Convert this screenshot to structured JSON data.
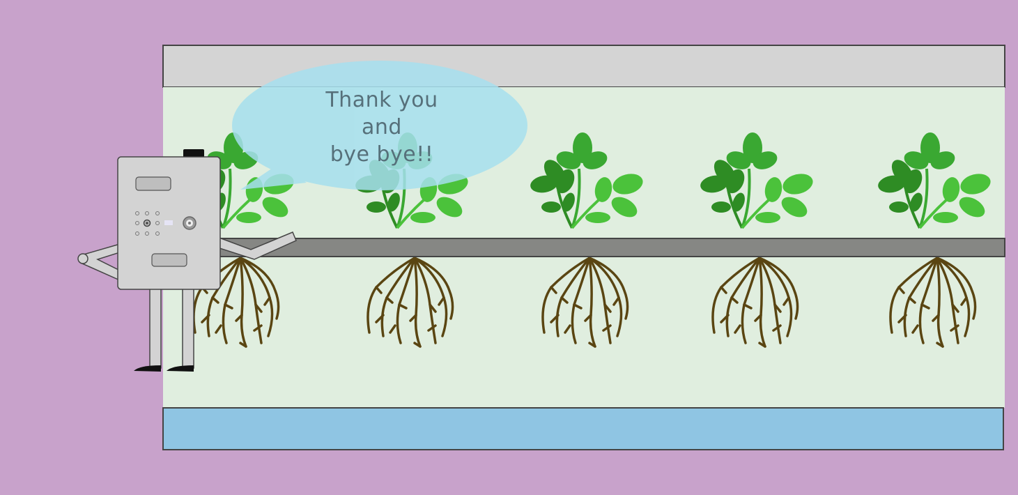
{
  "speech_bubble": {
    "text": "Thank you\nand\nbye bye!!"
  },
  "colors": {
    "background": "#c8a2cb",
    "tank_top": "#d4d4d4",
    "tank_interior": "#e0eedf",
    "water": "#8fc5e3",
    "rail": "#868784",
    "leaf_dark": "#2e8c24",
    "leaf_mid": "#3aa832",
    "leaf_light": "#4bc23b",
    "root": "#5a4512",
    "robot_body": "#d3d3d3",
    "bubble": "#a6dfee"
  },
  "plants": {
    "count": 5
  },
  "robot": {
    "icon": "robot-icon"
  }
}
